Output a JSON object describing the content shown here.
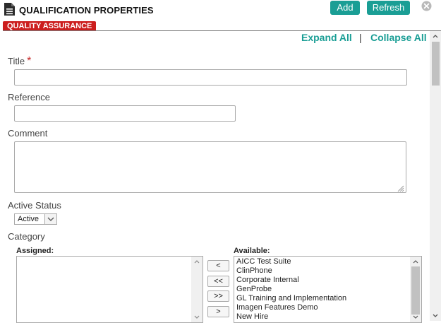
{
  "header": {
    "title": "QUALIFICATION PROPERTIES",
    "add_label": "Add",
    "refresh_label": "Refresh",
    "badge": "QUALITY ASSURANCE"
  },
  "toolbar": {
    "expand_all": "Expand All",
    "separator": "|",
    "collapse_all": "Collapse All"
  },
  "form": {
    "title_label": "Title",
    "required_marker": "*",
    "title_value": "",
    "reference_label": "Reference",
    "reference_value": "",
    "comment_label": "Comment",
    "comment_value": "",
    "active_status_label": "Active Status",
    "active_status_value": "Active",
    "category_label": "Category"
  },
  "category": {
    "assigned_label": "Assigned:",
    "available_label": "Available:",
    "assigned_items": [],
    "available_items": [
      "AICC Test Suite",
      "ClinPhone",
      "Corporate Internal",
      "GenProbe",
      "GL Training and Implementation",
      "Imagen Features Demo",
      "New Hire"
    ],
    "move_buttons": [
      "<",
      "<<",
      ">>",
      ">"
    ]
  },
  "colors": {
    "accent": "#1a9e95",
    "badge": "#cc1e1e",
    "required": "#c62828"
  },
  "icons": [
    "document-icon",
    "close-icon",
    "chevron-down-icon",
    "resize-grip-icon",
    "scroll-up-icon",
    "scroll-down-icon"
  ]
}
